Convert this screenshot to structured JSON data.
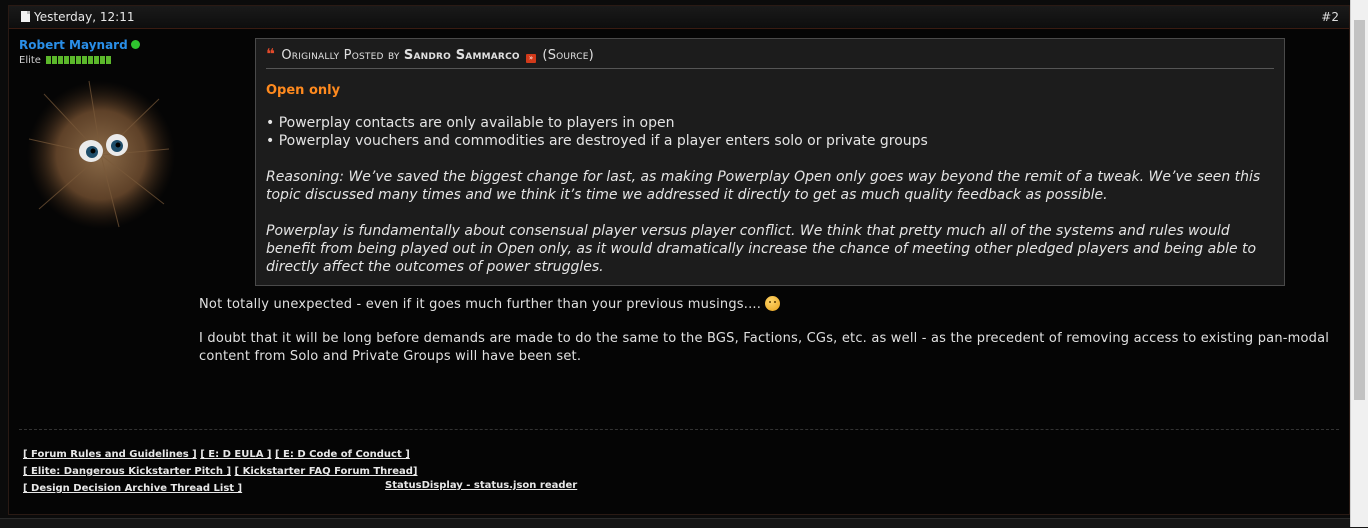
{
  "post": {
    "date": "Yesterday, 12:11",
    "number": "#2"
  },
  "user": {
    "name": "Robert Maynard",
    "rank": "Elite",
    "reputation_bars": 11,
    "online": true
  },
  "quote": {
    "prefix": "Originally Posted by",
    "author": "Sandro Sammarco",
    "source": "(Source)",
    "title": "Open only",
    "bullets": [
      "• Powerplay contacts are only available to players in open",
      "• Powerplay vouchers and commodities are destroyed if a player enters solo or private groups"
    ],
    "paragraph1": "Reasoning: We’ve saved the biggest change for last, as making Powerplay Open only goes way beyond the remit of a tweak. We’ve seen this topic discussed many times and we think it’s time we addressed it directly to get as much quality feedback as possible.",
    "paragraph2": "Powerplay is fundamentally about consensual player versus player conflict. We think that pretty much all of the systems and rules would benefit from being played out in Open only, as it would dramatically increase the chance of meeting other pledged players and being able to directly affect the outcomes of power struggles."
  },
  "reply": {
    "line1": "Not totally unexpected - even if it goes much further than your previous musings....",
    "line2": "I doubt that it will be long before demands are made to do the same to the BGS, Factions, CGs, etc. as well - as the precedent of removing access to existing pan-modal content from Solo and Private Groups will have been set."
  },
  "signature": {
    "link1": "[ Forum Rules and Guidelines ]",
    "link2": "[ E: D EULA ]",
    "link3": "[ E: D Code of Conduct ]",
    "link4": "[ Elite: Dangerous Kickstarter Pitch ]",
    "link5": "[ Kickstarter FAQ Forum Thread]",
    "link6": "[ Design Decision Archive Thread List ]",
    "link7": "StatusDisplay - status.json reader"
  },
  "colors": {
    "username": "#2a8fe8",
    "quote_title": "#ff8a1e",
    "online": "#2fc52f",
    "reputation": "#5cb82b"
  }
}
